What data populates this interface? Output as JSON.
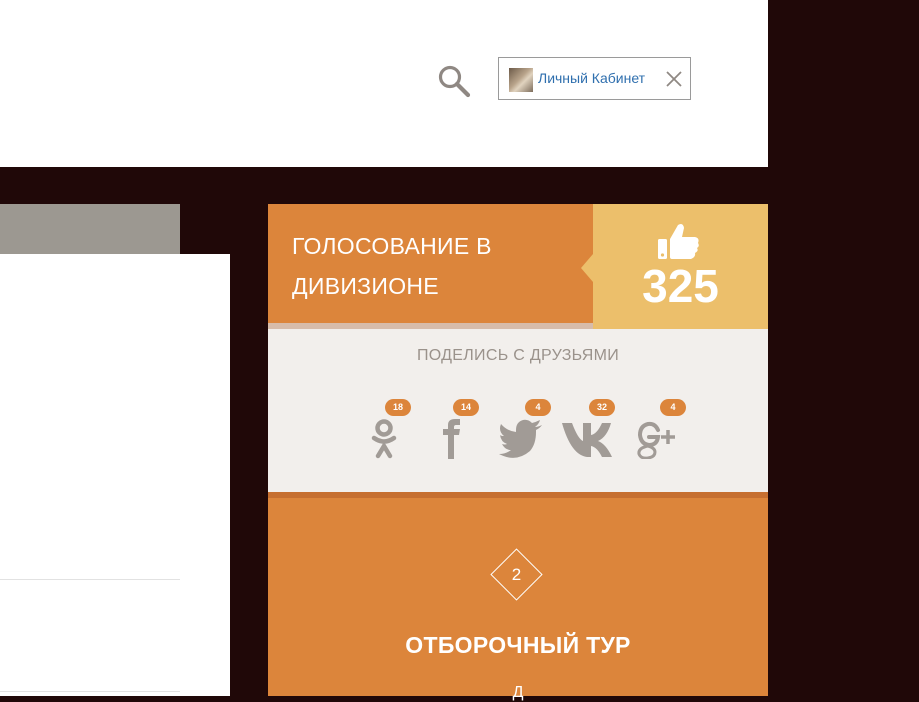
{
  "header": {
    "search_icon": "search-icon",
    "account_label": "Личный Кабинет",
    "close_icon": "close-icon"
  },
  "vote": {
    "title": "ГОЛОСОВАНИЕ В ДИВИЗИОНЕ",
    "icon": "thumbs-up-icon",
    "count": "325"
  },
  "share": {
    "title": "ПОДЕЛИСЬ С ДРУЗЬЯМИ",
    "networks": [
      {
        "name": "odnoklassniki",
        "count": "18"
      },
      {
        "name": "facebook",
        "count": "14"
      },
      {
        "name": "twitter",
        "count": "4"
      },
      {
        "name": "vk",
        "count": "32"
      },
      {
        "name": "google-plus",
        "count": "4"
      }
    ]
  },
  "round": {
    "number": "2",
    "title": "ОТБОРОЧНЫЙ ТУР",
    "subtitle": "Д"
  },
  "colors": {
    "page_bg": "#200808",
    "accent_orange": "#dc853b",
    "accent_yellow": "#ecbf6b",
    "share_bg": "#f2efec",
    "icon_gray": "#a19b96",
    "link_blue": "#2f6fae"
  }
}
